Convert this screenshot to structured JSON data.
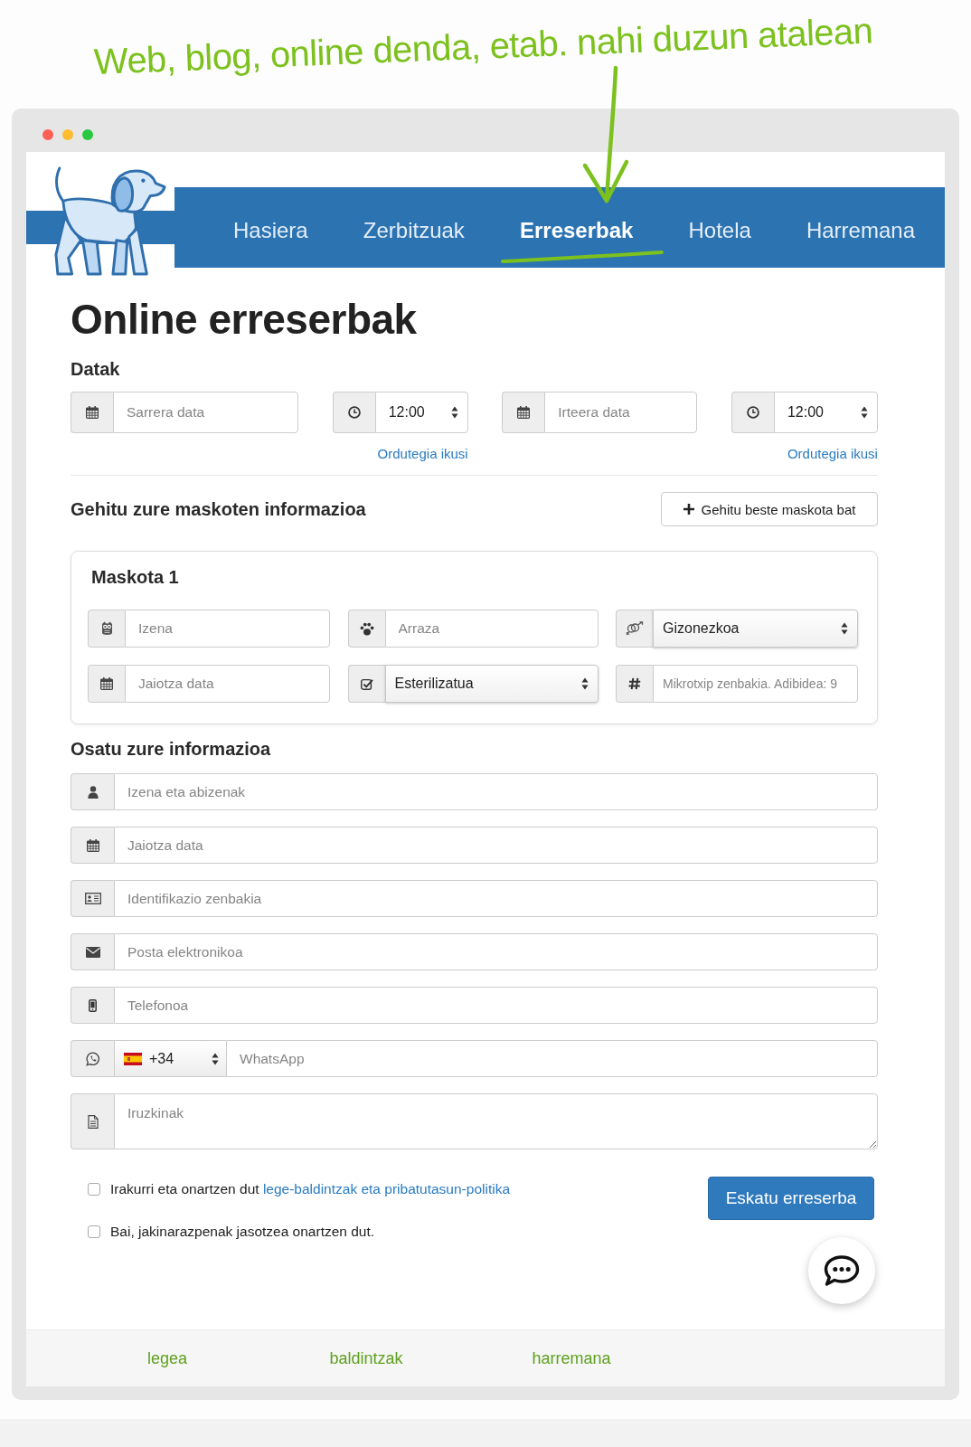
{
  "annotation": {
    "text": "Web, blog, online denda, etab. nahi duzun atalean"
  },
  "nav": {
    "items": [
      {
        "label": "Hasiera",
        "selected": false
      },
      {
        "label": "Zerbitzuak",
        "selected": false
      },
      {
        "label": "Erreserbak",
        "selected": true
      },
      {
        "label": "Hotela",
        "selected": false
      },
      {
        "label": "Harremana",
        "selected": false
      }
    ]
  },
  "title": "Online erreserbak",
  "dates": {
    "heading": "Datak",
    "fields": [
      {
        "kind": "date",
        "placeholder": "Sarrera data"
      },
      {
        "kind": "time",
        "value": "12:00",
        "link": "Ordutegia ikusi"
      },
      {
        "kind": "date",
        "placeholder": "Irteera data"
      },
      {
        "kind": "time",
        "value": "12:00",
        "link": "Ordutegia ikusi"
      }
    ]
  },
  "pets": {
    "heading": "Gehitu zure maskoten informazioa",
    "add_button": "Gehitu beste maskota bat",
    "cards": [
      {
        "title": "Maskota 1",
        "fields": [
          {
            "kind": "petname",
            "placeholder": "Izena"
          },
          {
            "kind": "breed",
            "placeholder": "Arraza"
          },
          {
            "kind": "sex",
            "value": "Gizonezkoa"
          },
          {
            "kind": "birthdate",
            "placeholder": "Jaiotza data"
          },
          {
            "kind": "sterile",
            "value": "Esterilizatua"
          },
          {
            "kind": "chip",
            "placeholder": "Mikrotxip zenbakia. Adibidea: 9"
          }
        ]
      }
    ]
  },
  "owner": {
    "heading": "Osatu zure informazioa",
    "fields": [
      {
        "kind": "fullname",
        "placeholder": "Izena eta abizenak"
      },
      {
        "kind": "birthdate",
        "placeholder": "Jaiotza data"
      },
      {
        "kind": "idnumber",
        "placeholder": "Identifikazio zenbakia"
      },
      {
        "kind": "email",
        "placeholder": "Posta elektronikoa"
      },
      {
        "kind": "phone",
        "placeholder": "Telefonoa"
      },
      {
        "kind": "whatsapp",
        "prefix": "+34",
        "placeholder": "WhatsApp"
      },
      {
        "kind": "comments",
        "placeholder": "Iruzkinak"
      }
    ]
  },
  "consents": [
    {
      "text": "Irakurri eta onartzen dut",
      "link": "lege-baldintzak eta pribatutasun-politika",
      "checked": false
    },
    {
      "text": "Bai, jakinarazpenak jasotzea onartzen dut.",
      "checked": false
    }
  ],
  "submit_button": "Eskatu erreserba",
  "footer": {
    "links": [
      "legea",
      "baldintzak",
      "harremana"
    ]
  }
}
